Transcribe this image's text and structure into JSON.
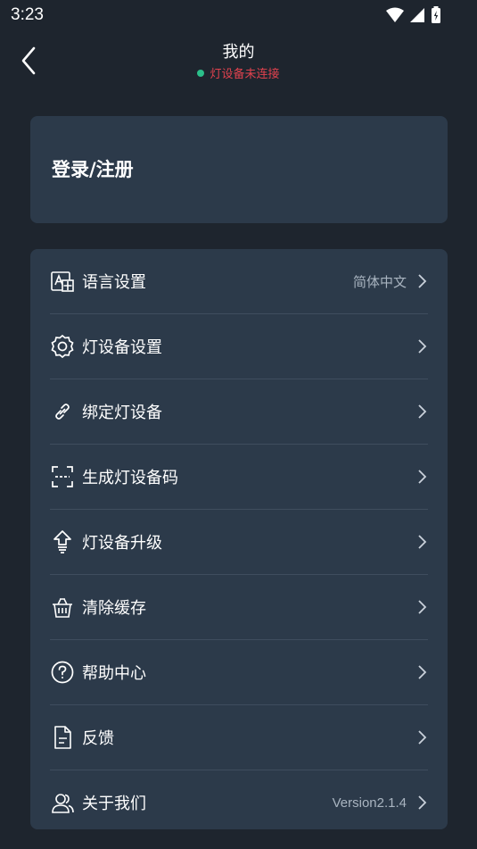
{
  "status_bar": {
    "time": "3:23"
  },
  "header": {
    "title": "我的",
    "subtitle": "灯设备未连接"
  },
  "login": {
    "label": "登录/注册"
  },
  "menu": {
    "items": [
      {
        "label": "语言设置",
        "value": "简体中文",
        "icon": "language-icon"
      },
      {
        "label": "灯设备设置",
        "value": "",
        "icon": "gear-icon"
      },
      {
        "label": "绑定灯设备",
        "value": "",
        "icon": "link-icon"
      },
      {
        "label": "生成灯设备码",
        "value": "",
        "icon": "scan-frame-icon"
      },
      {
        "label": "灯设备升级",
        "value": "",
        "icon": "upgrade-icon"
      },
      {
        "label": "清除缓存",
        "value": "",
        "icon": "basket-icon"
      },
      {
        "label": "帮助中心",
        "value": "",
        "icon": "help-circle-icon"
      },
      {
        "label": "反馈",
        "value": "",
        "icon": "document-icon"
      },
      {
        "label": "关于我们",
        "value": "Version2.1.4",
        "icon": "users-icon"
      }
    ]
  },
  "colors": {
    "background": "#1e252e",
    "card": "#2c3a4a",
    "disconnected_text": "#e0424e",
    "status_dot": "#2bbf8a"
  }
}
